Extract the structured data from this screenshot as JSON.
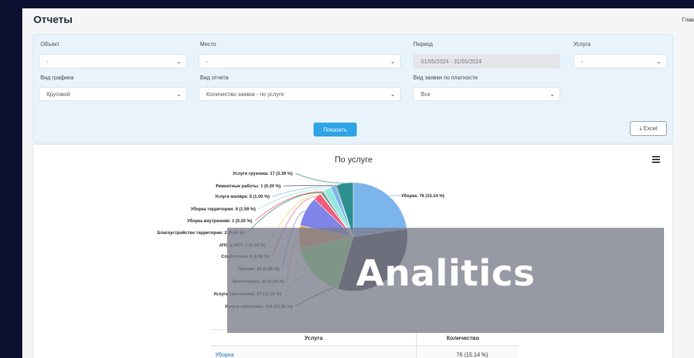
{
  "header": {
    "title": "Отчеты",
    "breadcrumb": "Глав"
  },
  "filters": {
    "object": {
      "label": "Объект",
      "value": "-"
    },
    "place": {
      "label": "Место",
      "value": "-"
    },
    "period": {
      "label": "Период",
      "value": "01/05/2024 - 31/05/2024"
    },
    "service": {
      "label": "Услуга",
      "value": "-"
    },
    "chart_type": {
      "label": "Вид графика",
      "value": "Круговой"
    },
    "report_type": {
      "label": "Вид отчета",
      "value": "Количество заявок - по услуге"
    },
    "payment_type": {
      "label": "Вид заявки по платности",
      "value": "Все"
    },
    "show_button": "Показать",
    "excel_button": "⤓ Excel"
  },
  "chart_data": {
    "type": "pie",
    "title": "По услуге",
    "slices": [
      {
        "name": "Уборка",
        "value": 76,
        "label": "Уборка: 76 (15.14 %)",
        "color": "#7cb5ec"
      },
      {
        "name": "Услуги электрика",
        "value": 108,
        "label": "Услуги электрика: 108 (21.51 %)",
        "color": "#434348"
      },
      {
        "name": "Услуги сантехника",
        "value": 57,
        "label": "Услуги сантехника: 57 (11.35 %)",
        "color": "#90ed7d"
      },
      {
        "name": "Вентиляция",
        "value": 23,
        "label": "Вентиляция: 23 (4.58 %)",
        "color": "#f7a35c"
      },
      {
        "name": "Прочее",
        "value": 30,
        "label": "Прочее: 30 (5.98 %)",
        "color": "#8085e9"
      },
      {
        "name": "Слаботочка",
        "value": 8,
        "label": "Слаботочка: 8 (1.59 %)",
        "color": "#f15c80"
      },
      {
        "name": "АПС и АПТ",
        "value": 1,
        "label": "АПС и АПТ: 1 (0.20 %)",
        "color": "#e4d354"
      },
      {
        "name": "Благоустройство территории",
        "value": 2,
        "label": "Благоустройство территории: 2 (0.40 %)",
        "color": "#2b908f"
      },
      {
        "name": "Уборка внутренняя",
        "value": 1,
        "label": "Уборка внутренняя: 1 (0.20 %)",
        "color": "#f45b5b"
      },
      {
        "name": "Уборка территории",
        "value": 8,
        "label": "Уборка территории: 8 (1.59 %)",
        "color": "#91e8e1"
      },
      {
        "name": "Услуги маляра",
        "value": 5,
        "label": "Услуги маляра: 5 (1.00 %)",
        "color": "#7cb5ec"
      },
      {
        "name": "Ремонтные работы",
        "value": 1,
        "label": "Ремонтные работы: 1 (0.20 %)",
        "color": "#434348"
      },
      {
        "name": "Услуги грузчика",
        "value": 17,
        "label": "Услуги грузчика: 17 (3.39 %)",
        "color": "#2b908f"
      }
    ]
  },
  "table": {
    "headers": [
      "Услуга",
      "Количество"
    ],
    "rows": [
      {
        "service": "Уборка",
        "count": "76 (15.14 %)"
      }
    ]
  },
  "overlay": {
    "text": "Analitics"
  }
}
